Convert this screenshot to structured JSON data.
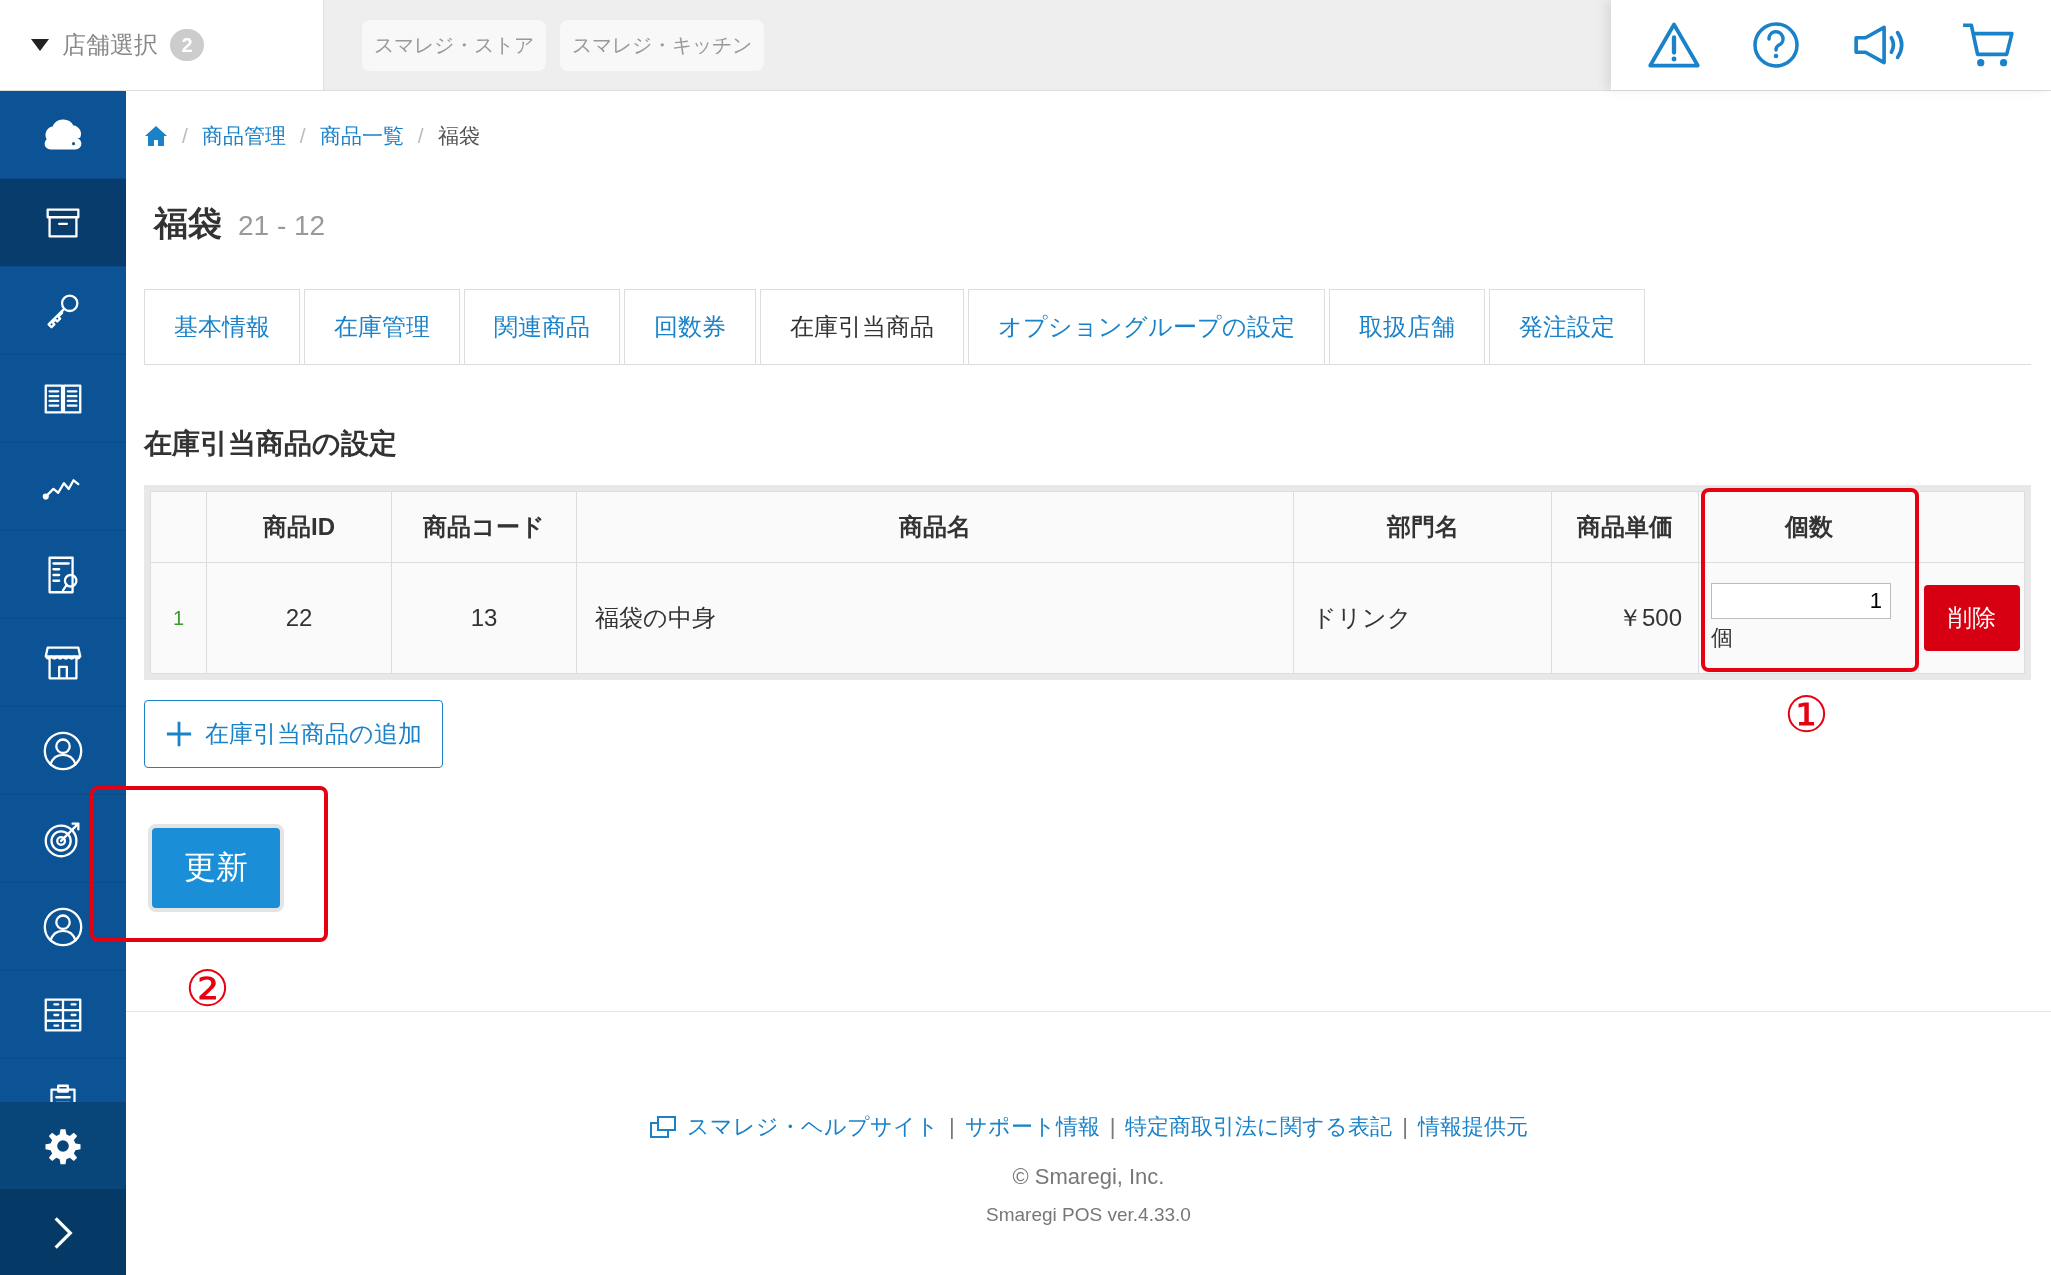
{
  "store_selector": {
    "label": "店舗選択",
    "count": "2"
  },
  "stores": [
    "スマレジ・ストア",
    "スマレジ・キッチン"
  ],
  "sidebar": {
    "items": [
      {
        "kind": "cloud",
        "selected": false
      },
      {
        "kind": "box",
        "selected": true
      },
      {
        "kind": "key",
        "selected": false
      },
      {
        "kind": "book",
        "selected": false
      },
      {
        "kind": "chart",
        "selected": false
      },
      {
        "kind": "report",
        "selected": false
      },
      {
        "kind": "store",
        "selected": false
      },
      {
        "kind": "staff",
        "selected": false
      },
      {
        "kind": "target",
        "selected": false
      },
      {
        "kind": "member",
        "selected": false
      },
      {
        "kind": "shelf",
        "selected": false
      },
      {
        "kind": "clipboard",
        "selected": false
      }
    ]
  },
  "breadcrumb": [
    "商品管理",
    "商品一覧",
    "福袋"
  ],
  "breadcrumb_separator": "/",
  "title": "福袋",
  "subtitle": "21 - 12",
  "tabs": [
    {
      "label": "基本情報",
      "selected": false
    },
    {
      "label": "在庫管理",
      "selected": false
    },
    {
      "label": "関連商品",
      "selected": false
    },
    {
      "label": "回数券",
      "selected": false
    },
    {
      "label": "在庫引当商品",
      "selected": true
    },
    {
      "label": "オプショングループの設定",
      "selected": false
    },
    {
      "label": "取扱店舗",
      "selected": false
    },
    {
      "label": "発注設定",
      "selected": false
    }
  ],
  "section_title": "在庫引当商品の設定",
  "table": {
    "columns": [
      "商品ID",
      "商品コード",
      "商品名",
      "部門名",
      "商品単価",
      "個数"
    ],
    "rows": [
      {
        "number": "1",
        "product_id": "22",
        "product_code": "13",
        "name": "福袋の中身",
        "department": "ドリンク",
        "price": "￥500",
        "quantity": "1",
        "unit": "個",
        "delete": "削除"
      }
    ]
  },
  "add_button": "在庫引当商品の追加",
  "update_button": "更新",
  "annotations": [
    {
      "label": "①"
    },
    {
      "label": "②"
    }
  ],
  "footer": {
    "links": [
      "スマレジ・ヘルプサイト",
      "サポート情報",
      "特定商取引法に関する表記",
      "情報提供元"
    ],
    "separator": "|",
    "copyright": "© Smaregi, Inc.",
    "version": "Smaregi POS ver.4.33.0"
  }
}
